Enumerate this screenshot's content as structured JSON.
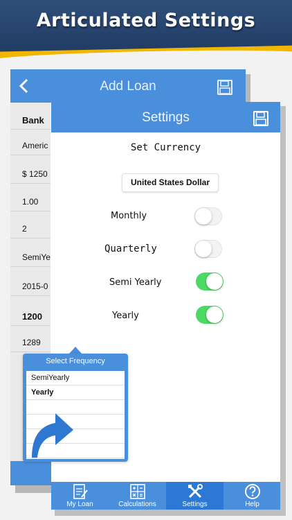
{
  "banner": {
    "title": "Articulated Settings"
  },
  "add_loan": {
    "title": "Add Loan",
    "rows": [
      {
        "text": "Bank",
        "bold": true
      },
      {
        "text": "Americ",
        "bold": false
      },
      {
        "text": "$  1250",
        "bold": false
      },
      {
        "text": "1.00",
        "bold": false
      },
      {
        "text": "2",
        "bold": false
      },
      {
        "text": "SemiYe",
        "bold": false
      },
      {
        "text": "2015-0",
        "bold": false
      },
      {
        "text": "1200",
        "bold": true
      },
      {
        "text": "1289",
        "bold": false
      }
    ]
  },
  "settings": {
    "title": "Settings",
    "set_currency_label": "Set Currency",
    "currency_value": "United States Dollar",
    "frequencies": [
      {
        "label": "Monthly",
        "on": false
      },
      {
        "label": "Quarterly",
        "on": false
      },
      {
        "label": "Semi Yearly",
        "on": true
      },
      {
        "label": "Yearly",
        "on": true
      }
    ]
  },
  "popover": {
    "title": "Select Frequency",
    "items": [
      "SemiYearly",
      "Yearly",
      "",
      "",
      "",
      ""
    ],
    "selected_index": 1
  },
  "tabs": [
    {
      "label": "My Loan",
      "icon": "document-icon",
      "active": false
    },
    {
      "label": "Calculations",
      "icon": "calculator-icon",
      "active": false
    },
    {
      "label": "Settings",
      "icon": "tools-icon",
      "active": true
    },
    {
      "label": "Help",
      "icon": "help-icon",
      "active": false
    }
  ],
  "colors": {
    "banner": "#1f3b63",
    "accent_stripe": "#f2b500",
    "header_blue": "#4a8fdc",
    "active_tab": "#2d78d4",
    "toggle_on": "#4cd964"
  }
}
